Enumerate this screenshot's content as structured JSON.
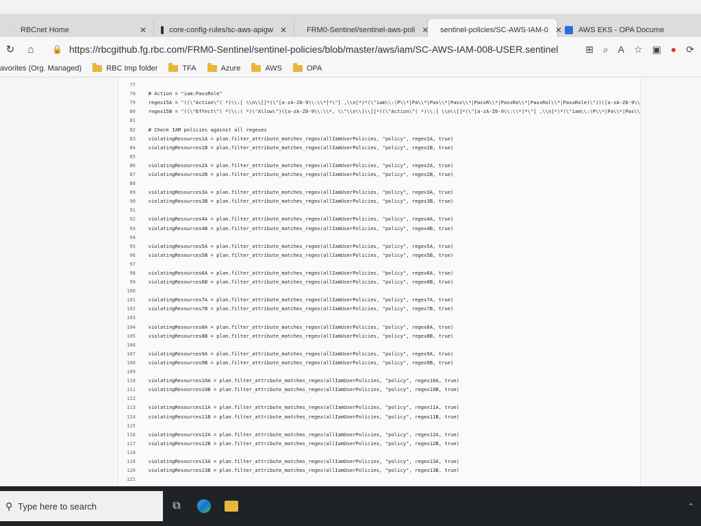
{
  "tabs": [
    {
      "label": "RBCnet Home",
      "favicon_color": "#d9d9d9",
      "active": false
    },
    {
      "label": "core-config-rules/sc-aws-apigw",
      "favicon_color": "#333333",
      "active": false
    },
    {
      "label": "FRM0-Sentinel/sentinel-aws-poli",
      "favicon_color": "#333333",
      "active": false
    },
    {
      "label": "sentinel-policies/SC-AWS-IAM-0",
      "favicon_color": "#333333",
      "active": true
    },
    {
      "label": "AWS EKS - OPA Docume",
      "favicon_color": "#2f6bd6",
      "active": false
    }
  ],
  "address_bar": {
    "url": "https://rbcgithub.fg.rbc.com/FRM0-Sentinel/sentinel-policies/blob/master/aws/iam/SC-AWS-IAM-008-USER.sentinel"
  },
  "bookmarks": [
    {
      "label": "avorites (Org. Managed)",
      "folder": false
    },
    {
      "label": "RBC Imp folder",
      "folder": true
    },
    {
      "label": "TFA",
      "folder": true
    },
    {
      "label": "Azure",
      "folder": true
    },
    {
      "label": "AWS",
      "folder": true
    },
    {
      "label": "OPA",
      "folder": true
    }
  ],
  "code_lines": [
    {
      "n": "77",
      "t": ""
    },
    {
      "n": "78",
      "t": "  # Action = \"iam:PassRole\""
    },
    {
      "n": "79",
      "t": "  regex15A = \"((\\\"Action\\\"( *)\\\\:[ \\\\n\\\\[]*(\\\"[a-zA-Z0-9\\\\:\\\\*]*\\\"[ ,\\\\n]*)*(\\\"iam\\\\:(P\\\\*|Pa\\\\*|Pas\\\\*|Pass\\\\*|PassR\\\\*|PassRo\\\\*|PassRol\\\\*|PassRole)\\\"))([a-zA-Z0-9\\\\:\\\\*, \\\\\""
    },
    {
      "n": "80",
      "t": "  regex15B = \"((\\\"Effect\\\"( *)\\\\:( *)\\\"Allow\\\")([a-zA-Z0-9\\\\:\\\\*, \\\\\"\\\\n\\\\]\\\\[]*)(\\\"Action\\\"( *)\\\\:[ \\\\n\\\\[]*(\\\"[a-zA-Z0-9\\\\:\\\\*]*\\\"[ ,\\\\n]*)*(\\\"iam\\\\:(P\\\\*|Pa\\\\*|Pas\\\\*|Pa"
    },
    {
      "n": "81",
      "t": ""
    },
    {
      "n": "82",
      "t": "  # Check IAM policies against all regexes"
    },
    {
      "n": "83",
      "t": "  violatingResources1A = plan.filter_attribute_matches_regex(allIamUserPolicies, \"policy\", regex1A, true)"
    },
    {
      "n": "84",
      "t": "  violatingResources1B = plan.filter_attribute_matches_regex(allIamUserPolicies, \"policy\", regex1B, true)"
    },
    {
      "n": "85",
      "t": ""
    },
    {
      "n": "86",
      "t": "  violatingResources2A = plan.filter_attribute_matches_regex(allIamUserPolicies, \"policy\", regex2A, true)"
    },
    {
      "n": "87",
      "t": "  violatingResources2B = plan.filter_attribute_matches_regex(allIamUserPolicies, \"policy\", regex2B, true)"
    },
    {
      "n": "88",
      "t": ""
    },
    {
      "n": "89",
      "t": "  violatingResources3A = plan.filter_attribute_matches_regex(allIamUserPolicies, \"policy\", regex3A, true)"
    },
    {
      "n": "90",
      "t": "  violatingResources3B = plan.filter_attribute_matches_regex(allIamUserPolicies, \"policy\", regex3B, true)"
    },
    {
      "n": "91",
      "t": ""
    },
    {
      "n": "92",
      "t": "  violatingResources4A = plan.filter_attribute_matches_regex(allIamUserPolicies, \"policy\", regex4A, true)"
    },
    {
      "n": "93",
      "t": "  violatingResources4B = plan.filter_attribute_matches_regex(allIamUserPolicies, \"policy\", regex4B, true)"
    },
    {
      "n": "94",
      "t": ""
    },
    {
      "n": "95",
      "t": "  violatingResources5A = plan.filter_attribute_matches_regex(allIamUserPolicies, \"policy\", regex5A, true)"
    },
    {
      "n": "96",
      "t": "  violatingResources5B = plan.filter_attribute_matches_regex(allIamUserPolicies, \"policy\", regex5B, true)"
    },
    {
      "n": "97",
      "t": ""
    },
    {
      "n": "98",
      "t": "  violatingResources6A = plan.filter_attribute_matches_regex(allIamUserPolicies, \"policy\", regex6A, true)"
    },
    {
      "n": "99",
      "t": "  violatingResources6B = plan.filter_attribute_matches_regex(allIamUserPolicies, \"policy\", regex6B, true)"
    },
    {
      "n": "100",
      "t": ""
    },
    {
      "n": "101",
      "t": "  violatingResources7A = plan.filter_attribute_matches_regex(allIamUserPolicies, \"policy\", regex7A, true)"
    },
    {
      "n": "102",
      "t": "  violatingResources7B = plan.filter_attribute_matches_regex(allIamUserPolicies, \"policy\", regex7B, true)"
    },
    {
      "n": "103",
      "t": ""
    },
    {
      "n": "104",
      "t": "  violatingResources8A = plan.filter_attribute_matches_regex(allIamUserPolicies, \"policy\", regex8A, true)"
    },
    {
      "n": "105",
      "t": "  violatingResources8B = plan.filter_attribute_matches_regex(allIamUserPolicies, \"policy\", regex8B, true)"
    },
    {
      "n": "106",
      "t": ""
    },
    {
      "n": "107",
      "t": "  violatingResources9A = plan.filter_attribute_matches_regex(allIamUserPolicies, \"policy\", regex9A, true)"
    },
    {
      "n": "108",
      "t": "  violatingResources9B = plan.filter_attribute_matches_regex(allIamUserPolicies, \"policy\", regex9B, true)"
    },
    {
      "n": "109",
      "t": ""
    },
    {
      "n": "110",
      "t": "  violatingResources10A = plan.filter_attribute_matches_regex(allIamUserPolicies, \"policy\", regex10A, true)"
    },
    {
      "n": "111",
      "t": "  violatingResources10B = plan.filter_attribute_matches_regex(allIamUserPolicies, \"policy\", regex10B, true)"
    },
    {
      "n": "112",
      "t": ""
    },
    {
      "n": "113",
      "t": "  violatingResources11A = plan.filter_attribute_matches_regex(allIamUserPolicies, \"policy\", regex11A, true)"
    },
    {
      "n": "114",
      "t": "  violatingResources11B = plan.filter_attribute_matches_regex(allIamUserPolicies, \"policy\", regex11B, true)"
    },
    {
      "n": "115",
      "t": ""
    },
    {
      "n": "116",
      "t": "  violatingResources12A = plan.filter_attribute_matches_regex(allIamUserPolicies, \"policy\", regex12A, true)"
    },
    {
      "n": "117",
      "t": "  violatingResources12B = plan.filter_attribute_matches_regex(allIamUserPolicies, \"policy\", regex12B, true)"
    },
    {
      "n": "118",
      "t": ""
    },
    {
      "n": "119",
      "t": "  violatingResources13A = plan.filter_attribute_matches_regex(allIamUserPolicies, \"policy\", regex13A, true)"
    },
    {
      "n": "120",
      "t": "  violatingResources13B = plan.filter_attribute_matches_regex(allIamUserPolicies, \"policy\", regex13B, true)"
    },
    {
      "n": "121",
      "t": ""
    }
  ],
  "taskbar": {
    "search_placeholder": "Type here to search"
  }
}
